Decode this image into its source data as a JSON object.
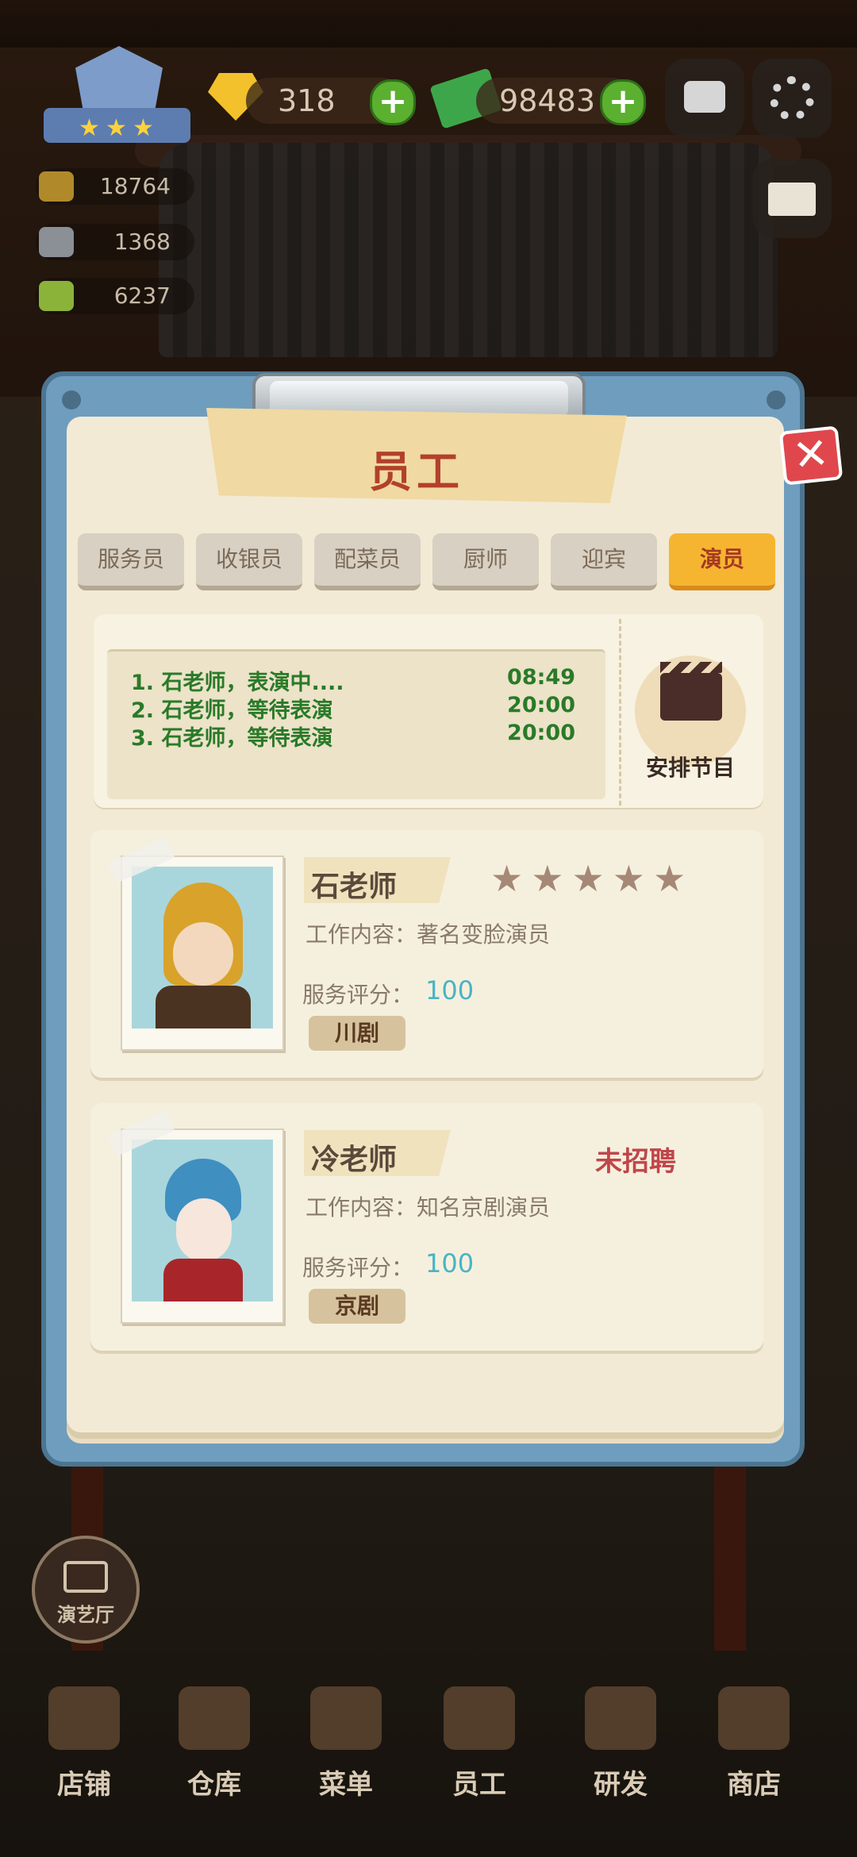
{
  "hud": {
    "gems": "318",
    "cash": "98483",
    "stats": [
      "18764",
      "1368",
      "6237"
    ],
    "icons": [
      "level-badge-icon",
      "gem-icon",
      "cash-icon",
      "camera-icon",
      "settings-gear-icon",
      "help-book-icon"
    ]
  },
  "dialog": {
    "title": "员工",
    "close_icon": "close-x-icon"
  },
  "tabs": [
    {
      "label": "服务员",
      "active": false
    },
    {
      "label": "收银员",
      "active": false
    },
    {
      "label": "配菜员",
      "active": false
    },
    {
      "label": "厨师",
      "active": false
    },
    {
      "label": "迎宾",
      "active": false
    },
    {
      "label": "演员",
      "active": true
    }
  ],
  "queue": {
    "items": [
      {
        "text": "1.  石老师，表演中....",
        "time": "08:49"
      },
      {
        "text": "2.  石老师，等待表演",
        "time": "20:00"
      },
      {
        "text": "3.  石老师，等待表演",
        "time": "20:00"
      }
    ],
    "arrange_label": "安排节目",
    "arrange_icon": "clapperboard-icon"
  },
  "performers": [
    {
      "name": "石老师",
      "desc": "工作内容：著名变脸演员",
      "score_label": "服务评分：",
      "score": "100",
      "genre": "川剧",
      "stars": "★★★★★",
      "status": ""
    },
    {
      "name": "冷老师",
      "desc": "工作内容：知名京剧演员",
      "score_label": "服务评分：",
      "score": "100",
      "genre": "京剧",
      "stars": "",
      "status": "未招聘"
    }
  ],
  "side": {
    "theater_label": "演艺厅"
  },
  "nav": [
    "店铺",
    "仓库",
    "菜单",
    "员工",
    "研发",
    "商店"
  ],
  "colors": {
    "frame": "#6f9dbd",
    "active_tab": "#f6b530",
    "title": "#b2402c",
    "queue_text": "#2a7a28",
    "score": "#4ab3c4"
  }
}
